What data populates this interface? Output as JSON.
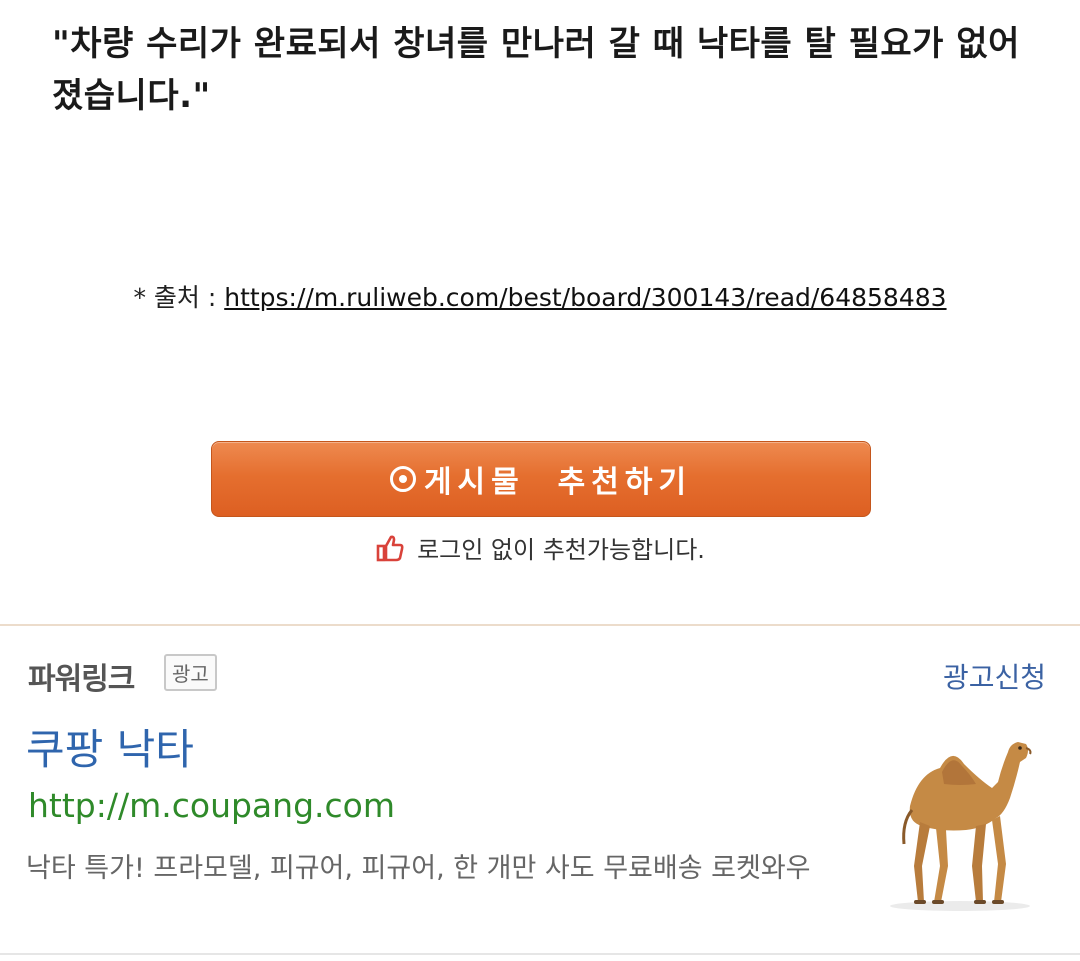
{
  "article": {
    "quote": "\"차량 수리가 완료되서 창녀를 만나러 갈 때 낙타를 탈 필요가 없어졌습니다.\"",
    "source_prefix": "* 출처 : ",
    "source_url": "https://m.ruliweb.com/best/board/300143/read/64858483"
  },
  "recommend": {
    "button_label": "게시물  추천하기",
    "note": "로그인 없이 추천가능합니다."
  },
  "ad": {
    "section_title": "파워링크",
    "badge": "광고",
    "apply_link": "광고신청",
    "title": "쿠팡 낙타",
    "url": "http://m.coupang.com",
    "description": "낙타 특가! 프라모델, 피규어, 피규어, 한 개만 사도 무료배송 로켓와우",
    "image_icon": "camel-figure-image"
  },
  "colors": {
    "button_orange": "#e56f2f",
    "ad_title_blue": "#2f65ad",
    "ad_url_green": "#2f8a2a",
    "thumb_red": "#d9423a"
  }
}
